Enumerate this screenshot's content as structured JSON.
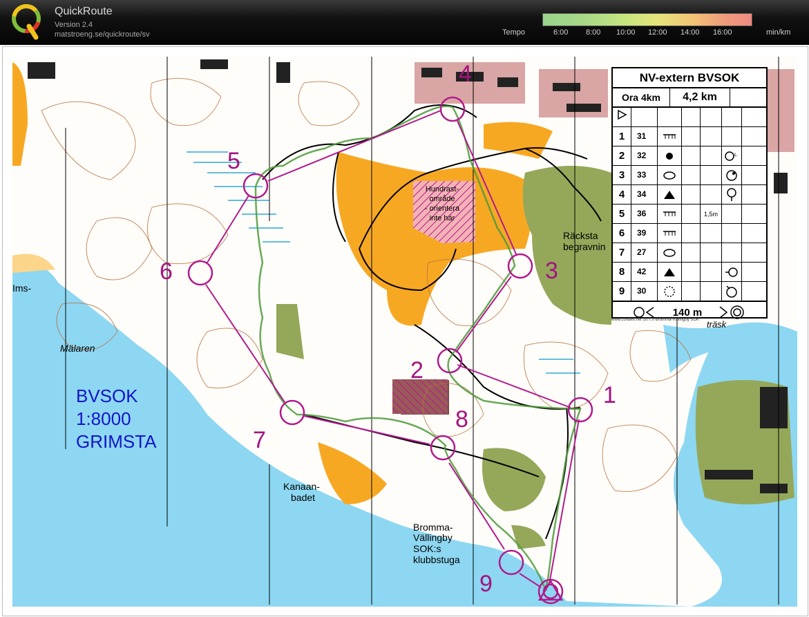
{
  "app": {
    "title": "QuickRoute",
    "version": "Version 2.4",
    "url": "matstroeng.se/quickroute/sv"
  },
  "tempo": {
    "label": "Tempo",
    "ticks": [
      "6:00",
      "8:00",
      "10:00",
      "12:00",
      "14:00",
      "16:00"
    ],
    "unit": "min/km"
  },
  "map": {
    "labels": {
      "ims": "Ims-",
      "malaren": "Mälaren",
      "kanaan1": "Kanaan-",
      "kanaan2": "badet",
      "bromma1": "Bromma-",
      "bromma2": "Vällingby",
      "bromma3": "SOK:s",
      "bromma4": "klubbstuga",
      "racksta1": "Räcksta",
      "racksta2": "begravnin",
      "trask": "träsk",
      "hund1": "Hundrast-",
      "hund2": "område",
      "hund3": "- orientera",
      "hund4": "inte här"
    },
    "info": {
      "line1": "BVSOK",
      "line2": "1:8000",
      "line3": "GRIMSTA"
    },
    "control_numbers": [
      "1",
      "2",
      "3",
      "4",
      "5",
      "6",
      "7",
      "8",
      "9"
    ]
  },
  "legend": {
    "title": "NV-extern BVSOK",
    "course": "Ora 4km",
    "length": "4,2 km",
    "rows": [
      {
        "num": "1",
        "code": "31",
        "sym": "cliff",
        "extra": "",
        "f": ""
      },
      {
        "num": "2",
        "code": "32",
        "sym": "dot",
        "extra": "circ-l",
        "f": ""
      },
      {
        "num": "3",
        "code": "33",
        "sym": "ellipse",
        "extra": "circ-tr",
        "f": ""
      },
      {
        "num": "4",
        "code": "34",
        "sym": "triangle",
        "extra": "circ-b",
        "f": ""
      },
      {
        "num": "5",
        "code": "36",
        "sym": "cliff",
        "extra": "",
        "f": "1,5m"
      },
      {
        "num": "6",
        "code": "39",
        "sym": "cliff",
        "extra": "",
        "f": ""
      },
      {
        "num": "7",
        "code": "27",
        "sym": "ellipse",
        "extra": "",
        "f": ""
      },
      {
        "num": "8",
        "code": "42",
        "sym": "triangle",
        "extra": "circ-left",
        "f": ""
      },
      {
        "num": "9",
        "code": "30",
        "sym": "dashcircle",
        "extra": "circ-tl",
        "f": ""
      }
    ],
    "finish": "140 m",
    "credit": "www.condes.net 10.7.0 Bromma-Vällingby SOK"
  },
  "colors": {
    "course": "#b01a8c",
    "water": "#8dd7f2",
    "open": "#f7a823",
    "green": "#95a85a",
    "info": "#1414c8"
  }
}
